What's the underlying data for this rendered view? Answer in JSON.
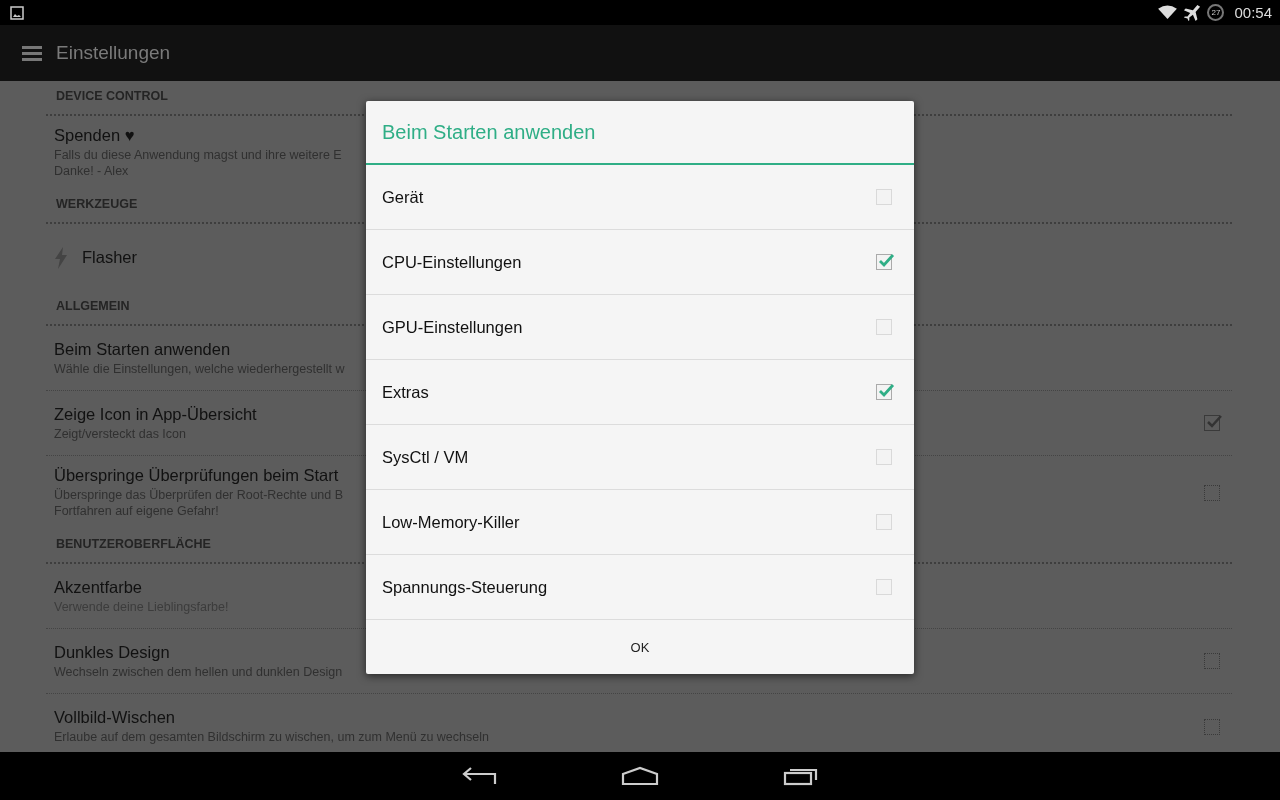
{
  "status_bar": {
    "battery": "27",
    "time": "00:54"
  },
  "action_bar": {
    "title": "Einstellungen"
  },
  "settings": [
    {
      "kind": "header",
      "title": "DEVICE CONTROL"
    },
    {
      "kind": "item",
      "title": "Spenden ♥",
      "subtitle": "Falls du diese Anwendung magst und ihre weitere E\nDanke! - Alex"
    },
    {
      "kind": "header",
      "title": "WERKZEUGE"
    },
    {
      "kind": "tool",
      "title": "Flasher"
    },
    {
      "kind": "header",
      "title": "ALLGEMEIN"
    },
    {
      "kind": "item",
      "title": "Beim Starten anwenden",
      "subtitle": "Wähle die Einstellungen, welche wiederhergestellt w"
    },
    {
      "kind": "check",
      "title": "Zeige Icon in App-Übersicht",
      "subtitle": "Zeigt/versteckt das Icon",
      "checked": true
    },
    {
      "kind": "check",
      "title": "Überspringe Überprüfungen beim Start",
      "subtitle": "Überspringe das Überprüfen der Root-Rechte und B\nFortfahren auf eigene Gefahr!",
      "checked": false
    },
    {
      "kind": "header",
      "title": "BENUTZEROBERFLÄCHE"
    },
    {
      "kind": "item",
      "title": "Akzentfarbe",
      "subtitle": "Verwende deine Lieblingsfarbe!",
      "disabled": true
    },
    {
      "kind": "check",
      "title": "Dunkles Design",
      "subtitle": "Wechseln zwischen dem hellen und dunklen Design",
      "checked": false
    },
    {
      "kind": "check",
      "title": "Vollbild-Wischen",
      "subtitle": "Erlaube auf dem gesamten Bildschirm zu wischen, um zum Menü zu wechseln",
      "checked": false
    }
  ],
  "dialog": {
    "title": "Beim Starten anwenden",
    "options": [
      {
        "label": "Gerät",
        "checked": false
      },
      {
        "label": "CPU-Einstellungen",
        "checked": true
      },
      {
        "label": "GPU-Einstellungen",
        "checked": false
      },
      {
        "label": "Extras",
        "checked": true
      },
      {
        "label": "SysCtl / VM",
        "checked": false
      },
      {
        "label": "Low-Memory-Killer",
        "checked": false
      },
      {
        "label": "Spannungs-Steuerung",
        "checked": false
      }
    ],
    "button": "OK"
  }
}
